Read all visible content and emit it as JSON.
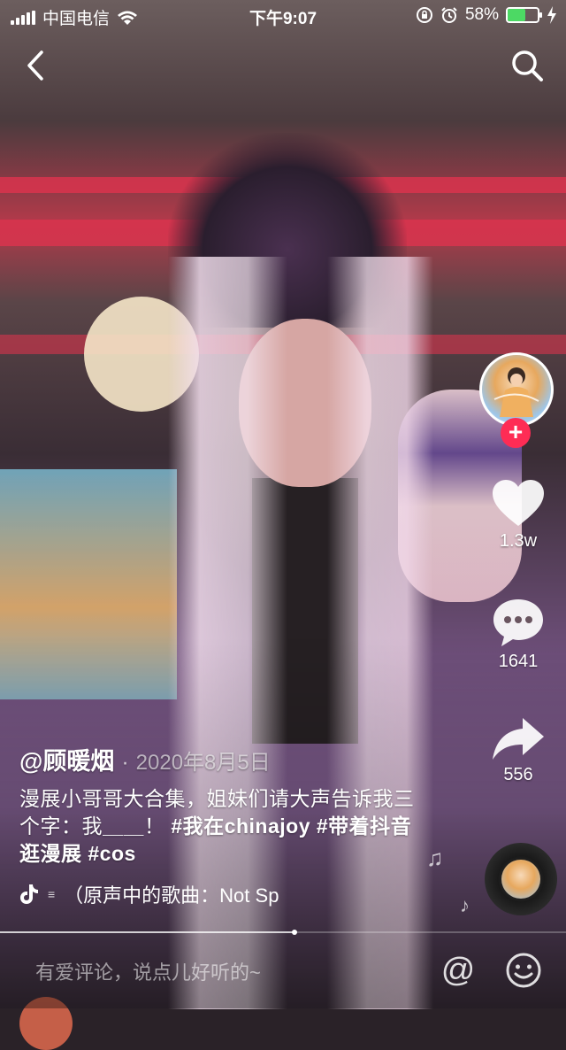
{
  "status_bar": {
    "carrier": "中国电信",
    "time": "下午9:07",
    "battery_percent": "58%",
    "battery_level": 0.58,
    "battery_color": "#4cd964",
    "icons": [
      "signal-icon",
      "wifi-icon",
      "orientation-lock-icon",
      "alarm-icon",
      "battery-icon",
      "charging-icon"
    ]
  },
  "nav": {
    "back_icon": "chevron-left-icon",
    "search_icon": "search-icon"
  },
  "side_actions": {
    "follow_label": "+",
    "follow_color": "#fe2c55",
    "like_count": "1.3w",
    "comment_count": "1641",
    "share_count": "556"
  },
  "post": {
    "author": "@顾暖烟",
    "separator": "·",
    "date": "2020年8月5日",
    "caption_text": "漫展小哥哥大合集，姐妹们请大声告诉我三个字：我＿＿！",
    "hashtags": [
      "#我在chinajoy",
      "#带着抖音逛漫展",
      "#cos"
    ],
    "music": "（原声中的歌曲：Not Sp"
  },
  "progress": {
    "played_fraction": 0.52
  },
  "comment_bar": {
    "placeholder": "有爱评论，说点儿好听的~",
    "at_label": "@",
    "emoji_icon": "smiley-icon"
  }
}
